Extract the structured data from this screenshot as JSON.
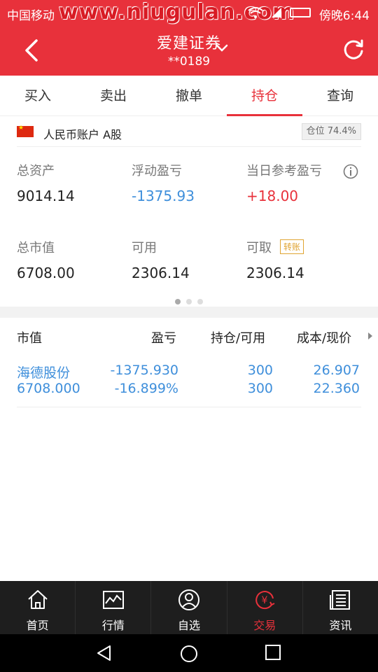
{
  "status_bar": {
    "carrier": "中国移动",
    "time": "傍晚6:44",
    "watermark": "www.niugulan.com"
  },
  "header": {
    "title": "爱建证券",
    "subtitle": "**0189"
  },
  "tabs": [
    {
      "label": "买入"
    },
    {
      "label": "卖出"
    },
    {
      "label": "撤单"
    },
    {
      "label": "持仓",
      "active": true
    },
    {
      "label": "查询"
    }
  ],
  "account": {
    "name": "人民币账户 A股",
    "position_label": "仓位 74.4%"
  },
  "summary": {
    "total_assets": {
      "label": "总资产",
      "value": "9014.14"
    },
    "floating_pl": {
      "label": "浮动盈亏",
      "value": "-1375.93"
    },
    "daily_pl": {
      "label": "当日参考盈亏",
      "value": "+18.00"
    },
    "market_value": {
      "label": "总市值",
      "value": "6708.00"
    },
    "available": {
      "label": "可用",
      "value": "2306.14"
    },
    "withdrawable": {
      "label": "可取",
      "value": "2306.14",
      "transfer_label": "转账"
    }
  },
  "holdings": {
    "headers": [
      "市值",
      "盈亏",
      "持仓/可用",
      "成本/现价"
    ],
    "rows": [
      {
        "name": "海德股份",
        "market_value": "6708.000",
        "pl": "-1375.930",
        "pl_pct": "-16.899%",
        "position": "300",
        "available": "300",
        "cost": "26.907",
        "price": "22.360"
      }
    ]
  },
  "bottom_nav": [
    {
      "label": "首页",
      "icon": "home-icon"
    },
    {
      "label": "行情",
      "icon": "chart-icon"
    },
    {
      "label": "自选",
      "icon": "user-circle-icon"
    },
    {
      "label": "交易",
      "icon": "yen-trade-icon",
      "active": true
    },
    {
      "label": "资讯",
      "icon": "news-icon"
    }
  ],
  "colors": {
    "brand_red": "#e8313b",
    "value_blue": "#3f8fdb",
    "badge_gold": "#e0a431"
  }
}
